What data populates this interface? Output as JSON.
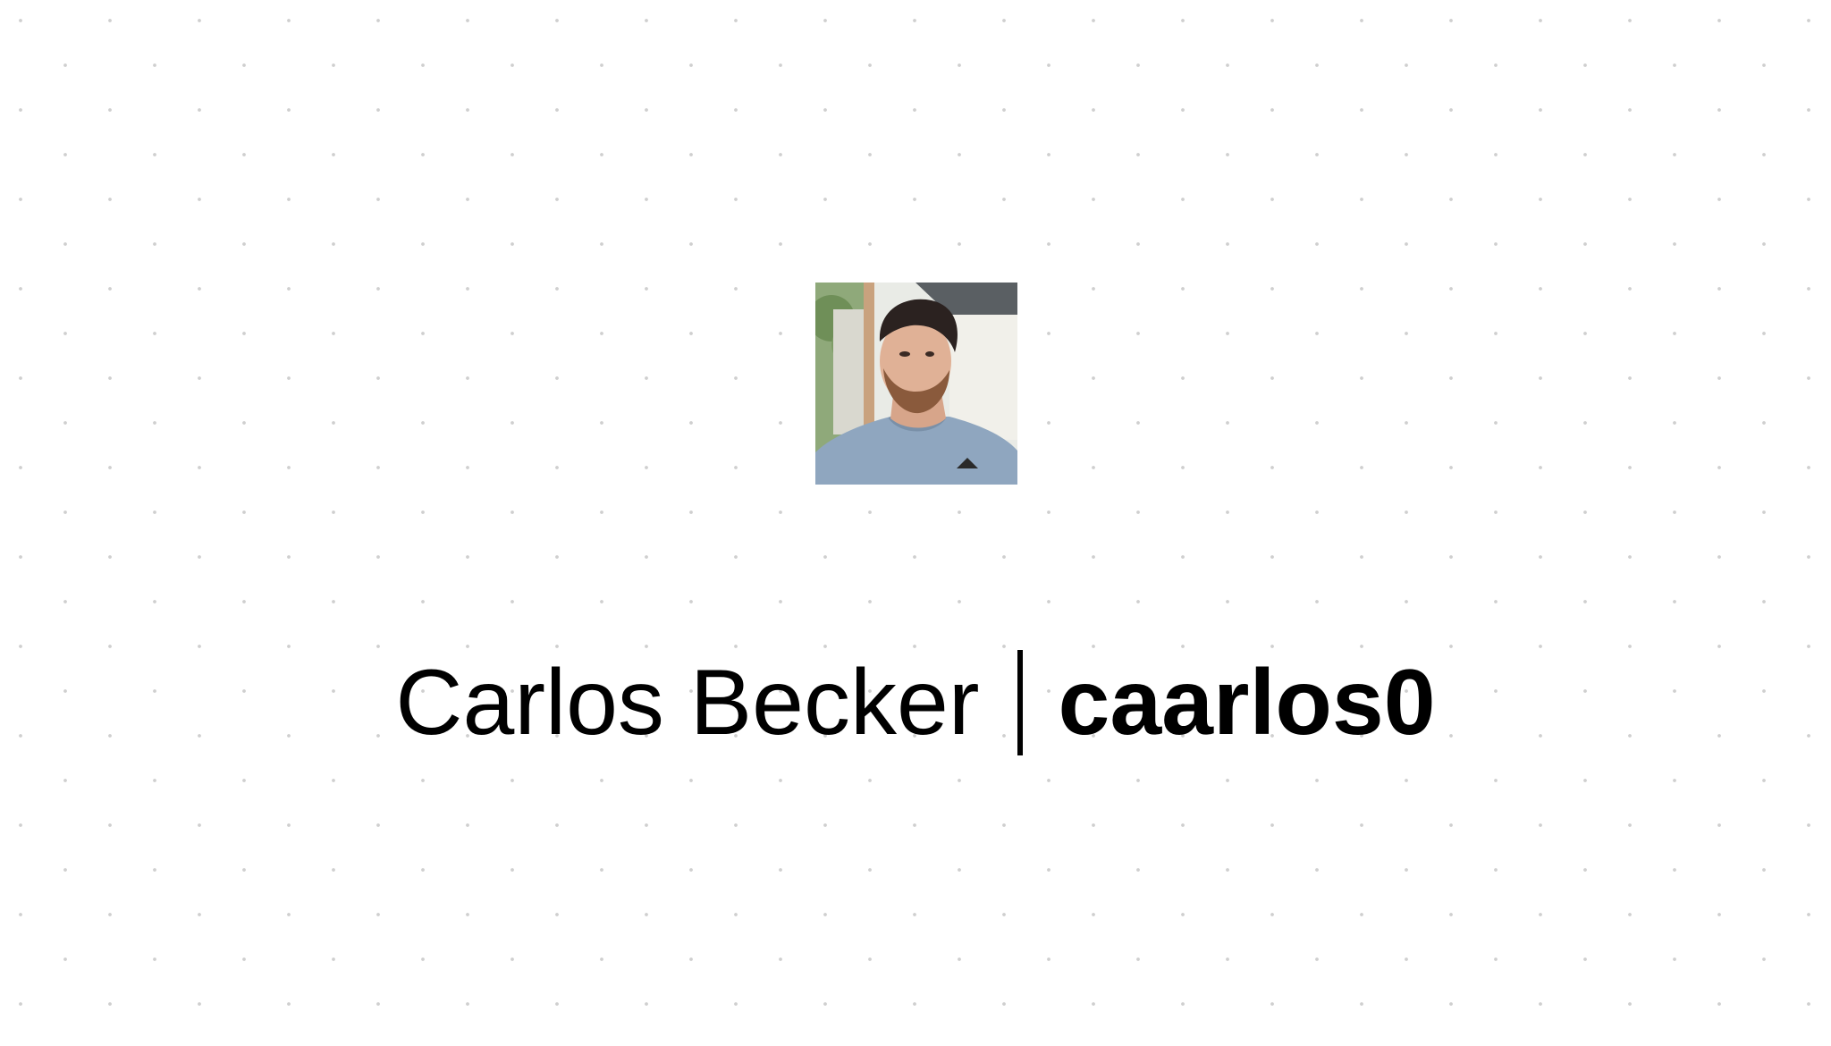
{
  "profile": {
    "full_name": "Carlos Becker",
    "separator": "|",
    "username": "caarlos0",
    "avatar_icon": "user-avatar-photo"
  },
  "colors": {
    "background": "#ffffff",
    "text": "#000000",
    "grid_dot": "#cfcfcf"
  }
}
